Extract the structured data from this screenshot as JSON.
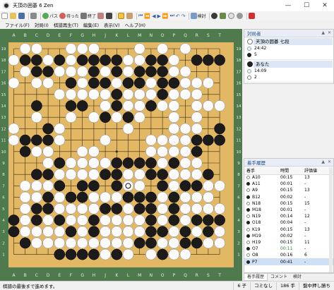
{
  "window": {
    "title": "天頂の囲碁 6 Zen"
  },
  "toolbar": {
    "pass_label": "パス",
    "undo_label": "待った",
    "finish_label": "終了",
    "study_label": "検討"
  },
  "menu": [
    "ファイル(F)",
    "対局(I)",
    "棋譜再生(T)",
    "編集(E)",
    "表示(V)",
    "ヘルプ(H)"
  ],
  "board": {
    "size": 19,
    "columns": [
      "A",
      "B",
      "C",
      "D",
      "E",
      "F",
      "G",
      "H",
      "J",
      "K",
      "L",
      "M",
      "N",
      "O",
      "P",
      "Q",
      "R",
      "S",
      "T"
    ],
    "rows": [
      "19",
      "18",
      "17",
      "16",
      "15",
      "14",
      "13",
      "12",
      "11",
      "10",
      "9",
      "8",
      "7",
      "6",
      "5",
      "4",
      "3",
      "2",
      "1"
    ],
    "colors": {
      "wood": "#e3b865",
      "frame": "#4e7a4e",
      "line": "#3b2a12"
    },
    "black": [
      "B18",
      "C18",
      "E18",
      "G18",
      "H18",
      "J18",
      "K18",
      "N18",
      "O18",
      "R18",
      "S18",
      "T18",
      "H17",
      "K17",
      "M17",
      "N17",
      "C17",
      "D17",
      "O17",
      "F16",
      "H16",
      "J16",
      "L16",
      "M16",
      "O16",
      "P16",
      "K15",
      "O15",
      "C14",
      "F14",
      "G14",
      "K14",
      "N14",
      "J13",
      "L13",
      "D12",
      "T12",
      "B11",
      "C11",
      "D11",
      "R11",
      "S11",
      "T11",
      "B10",
      "R10",
      "E9",
      "K9",
      "L9",
      "M9",
      "N9",
      "P9",
      "C8",
      "D8",
      "J8",
      "K8",
      "N8",
      "O8",
      "S8",
      "E7",
      "G7",
      "H7",
      "K7",
      "O7",
      "Q7",
      "R7",
      "D6",
      "F6",
      "G6",
      "L6",
      "M6",
      "N6",
      "P6",
      "C5",
      "D5",
      "J5",
      "K5",
      "M5",
      "N5",
      "P5",
      "A4",
      "C4",
      "E4",
      "H4",
      "N4",
      "P4",
      "R4",
      "S4",
      "T4",
      "A3",
      "F3",
      "H3",
      "N3",
      "O3",
      "Q3",
      "S3",
      "B2",
      "M2",
      "N2",
      "Q2",
      "R2",
      "E1",
      "F1",
      "G1",
      "H1",
      "K1",
      "O1"
    ],
    "white": [
      "B19",
      "C19",
      "F19",
      "G19",
      "H19",
      "M19",
      "O19",
      "Q19",
      "A18",
      "D18",
      "F18",
      "L18",
      "M18",
      "P18",
      "B17",
      "E17",
      "F17",
      "G17",
      "J17",
      "L17",
      "P17",
      "Q17",
      "A16",
      "C16",
      "D16",
      "G16",
      "K16",
      "N16",
      "Q16",
      "R16",
      "S16",
      "E15",
      "F15",
      "G15",
      "H15",
      "J15",
      "L15",
      "M15",
      "N15",
      "P15",
      "Q15",
      "R15",
      "J14",
      "L14",
      "M14",
      "O14",
      "P14",
      "R14",
      "S14",
      "T14",
      "C13",
      "F13",
      "H13",
      "K13",
      "M13",
      "P13",
      "R13",
      "A12",
      "E12",
      "L12",
      "P12",
      "Q12",
      "R12",
      "A11",
      "E11",
      "J11",
      "N11",
      "O11",
      "P11",
      "Q11",
      "C10",
      "D10",
      "G10",
      "H10",
      "N10",
      "O10",
      "P10",
      "Q10",
      "D9",
      "F9",
      "G9",
      "H9",
      "J9",
      "O9",
      "Q9",
      "R9",
      "E8",
      "F8",
      "G8",
      "H8",
      "L8",
      "M8",
      "P8",
      "Q8",
      "R8",
      "B7",
      "C7",
      "D7",
      "L7",
      "M7",
      "P7",
      "S7",
      "T7",
      "B6",
      "C6",
      "E6",
      "H6",
      "J6",
      "K6",
      "O6",
      "Q6",
      "R6",
      "S6",
      "B5",
      "E5",
      "F5",
      "G5",
      "H5",
      "L5",
      "O5",
      "Q5",
      "R5",
      "S5",
      "T5",
      "B4",
      "D4",
      "F4",
      "G4",
      "J4",
      "K4",
      "L4",
      "M4",
      "O4",
      "Q4",
      "B3",
      "C3",
      "D3",
      "E3",
      "G3",
      "J3",
      "K3",
      "L3",
      "M3",
      "P3",
      "R3",
      "T3",
      "C2",
      "D2",
      "E2",
      "F2",
      "G2",
      "H2",
      "J2",
      "K2",
      "L2",
      "O2",
      "P2",
      "S2",
      "T2",
      "J1",
      "L1",
      "N1",
      "P1",
      "Q1"
    ],
    "last_move": "L7"
  },
  "players_panel": {
    "title": "対局者",
    "white": {
      "name": "天頂の囲碁 七段",
      "time": "24:42",
      "captures": "5"
    },
    "black": {
      "name": "あなた",
      "time": "14:09",
      "captures": "2"
    }
  },
  "history_panel": {
    "title": "着手履歴",
    "headers": [
      "着手",
      "時間",
      "評価値"
    ],
    "rows": [
      {
        "color": "white",
        "move": "A10",
        "time": "00:15",
        "eval": "13"
      },
      {
        "color": "black",
        "move": "A11",
        "time": "00:01",
        "eval": "-"
      },
      {
        "color": "white",
        "move": "A9",
        "time": "00:15",
        "eval": "13"
      },
      {
        "color": "black",
        "move": "B12",
        "time": "00:02",
        "eval": "-"
      },
      {
        "color": "white",
        "move": "N18",
        "time": "00:15",
        "eval": "15"
      },
      {
        "color": "black",
        "move": "M18",
        "time": "00:01",
        "eval": "-"
      },
      {
        "color": "white",
        "move": "N19",
        "time": "00:14",
        "eval": "12"
      },
      {
        "color": "black",
        "move": "O18",
        "time": "00:04",
        "eval": "-"
      },
      {
        "color": "white",
        "move": "K19",
        "time": "00:15",
        "eval": "13"
      },
      {
        "color": "black",
        "move": "M19",
        "time": "00:02",
        "eval": "-"
      },
      {
        "color": "white",
        "move": "H19",
        "time": "00:15",
        "eval": "11"
      },
      {
        "color": "black",
        "move": "O7",
        "time": "00:11",
        "eval": "-"
      },
      {
        "color": "white",
        "move": "O8",
        "time": "00:16",
        "eval": "6"
      },
      {
        "color": "black",
        "move": "P7",
        "time": "00:41",
        "eval": "-"
      }
    ],
    "tabs": [
      "着手履歴",
      "コメント",
      "検討"
    ]
  },
  "status": {
    "message": "棋譜の最後まで進めます。",
    "handicap": "6 子",
    "komi": "コミなし",
    "move_count": "186 手",
    "mode": "盤中押し勝ち"
  }
}
